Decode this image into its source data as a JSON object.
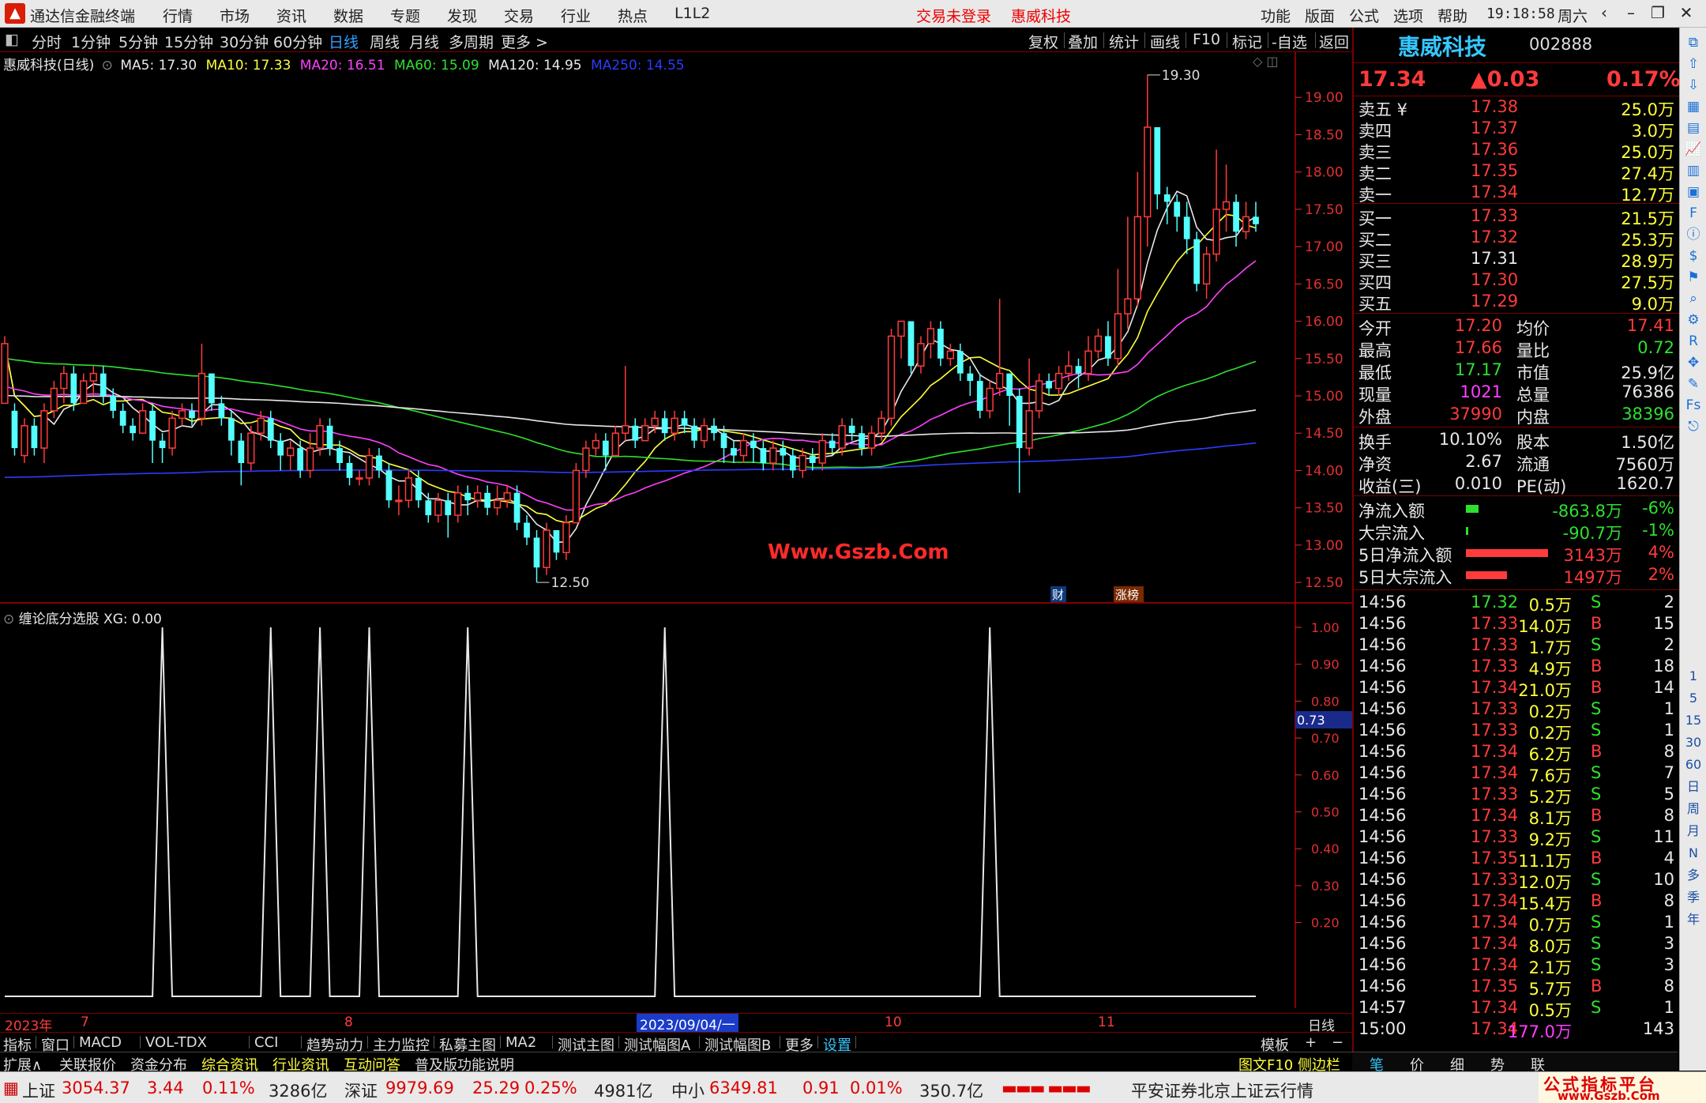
{
  "menubar": {
    "app_name": "通达信金融终端",
    "menus": [
      "行情",
      "市场",
      "资讯",
      "数据",
      "专题",
      "发现",
      "交易",
      "行业",
      "热点",
      "L1L2"
    ],
    "login_status": "交易未登录",
    "stock_title": "惠威科技",
    "right_menus": [
      "功能",
      "版面",
      "公式",
      "选项",
      "帮助"
    ],
    "time": "19:18:58",
    "weekday": "周六"
  },
  "period_bar": {
    "periods": [
      "分时",
      "1分钟",
      "5分钟",
      "15分钟",
      "30分钟",
      "60分钟",
      "日线",
      "周线",
      "月线",
      "多周期",
      "更多 >"
    ],
    "active": "日线",
    "tools": [
      "复权",
      "叠加",
      "统计",
      "画线",
      "F10",
      "标记",
      "-自选",
      "返回"
    ]
  },
  "main_chart": {
    "title": "惠威科技(日线)",
    "ma": [
      {
        "label": "MA5: 17.30",
        "color": "#e8e8e8"
      },
      {
        "label": "MA10: 17.33",
        "color": "#ffff3b"
      },
      {
        "label": "MA20: 16.51",
        "color": "#ff40ff"
      },
      {
        "label": "MA60: 15.09",
        "color": "#2ee02e"
      },
      {
        "label": "MA120: 14.95",
        "color": "#e8e8e8"
      },
      {
        "label": "MA250: 14.55",
        "color": "#2a3cff"
      }
    ],
    "high_label": "19.30",
    "low_label": "12.50",
    "watermark": "Www.Gszb.Com",
    "badges": [
      "财",
      "涨榜"
    ],
    "price_axis": [
      "19.00",
      "18.50",
      "18.00",
      "17.50",
      "17.00",
      "16.50",
      "16.00",
      "15.50",
      "15.00",
      "14.50",
      "14.00",
      "13.50",
      "13.00",
      "12.50"
    ],
    "axis_color": "#e03030"
  },
  "chart_data": {
    "type": "candlestick",
    "title": "惠威科技(日线)",
    "ylim": [
      12.3,
      19.5
    ],
    "x_labels": [
      "2023年",
      "7",
      "8",
      "2023/09/04/一",
      "10",
      "11"
    ],
    "candles": [
      [
        14.9,
        15.7,
        15.0,
        15.8
      ],
      [
        14.8,
        14.3,
        14.2,
        14.9
      ],
      [
        14.2,
        14.6,
        14.1,
        14.7
      ],
      [
        14.6,
        14.3,
        14.2,
        14.7
      ],
      [
        14.3,
        14.8,
        14.1,
        14.9
      ],
      [
        14.8,
        15.1,
        14.7,
        15.2
      ],
      [
        15.1,
        15.3,
        14.9,
        15.4
      ],
      [
        15.3,
        14.9,
        14.8,
        15.4
      ],
      [
        14.9,
        15.2,
        14.9,
        15.3
      ],
      [
        15.2,
        15.3,
        15.0,
        15.4
      ],
      [
        15.3,
        15.0,
        14.9,
        15.4
      ],
      [
        15.0,
        14.8,
        14.7,
        15.1
      ],
      [
        14.8,
        14.6,
        14.5,
        14.9
      ],
      [
        14.6,
        14.5,
        14.4,
        14.7
      ],
      [
        14.5,
        14.8,
        14.5,
        14.9
      ],
      [
        14.8,
        14.4,
        14.1,
        14.9
      ],
      [
        14.4,
        14.3,
        14.1,
        14.5
      ],
      [
        14.3,
        14.7,
        14.2,
        14.8
      ],
      [
        14.7,
        14.8,
        14.6,
        14.9
      ],
      [
        14.8,
        14.7,
        14.6,
        14.9
      ],
      [
        14.7,
        15.3,
        14.6,
        15.7
      ],
      [
        15.3,
        14.9,
        14.8,
        15.3
      ],
      [
        14.9,
        14.7,
        14.6,
        15.0
      ],
      [
        14.7,
        14.4,
        14.2,
        14.8
      ],
      [
        14.4,
        14.1,
        13.8,
        14.5
      ],
      [
        14.1,
        14.5,
        14.0,
        14.6
      ],
      [
        14.5,
        14.7,
        14.4,
        14.8
      ],
      [
        14.7,
        14.4,
        14.3,
        14.8
      ],
      [
        14.4,
        14.2,
        14.0,
        14.5
      ],
      [
        14.2,
        14.3,
        14.0,
        14.4
      ],
      [
        14.3,
        14.0,
        13.9,
        14.4
      ],
      [
        14.0,
        14.3,
        13.9,
        14.5
      ],
      [
        14.3,
        14.6,
        14.2,
        14.7
      ],
      [
        14.6,
        14.3,
        14.2,
        14.7
      ],
      [
        14.3,
        14.1,
        14.0,
        14.4
      ],
      [
        14.1,
        13.9,
        13.8,
        14.2
      ],
      [
        13.9,
        13.9,
        13.8,
        14.0
      ],
      [
        13.9,
        14.2,
        13.8,
        14.3
      ],
      [
        14.2,
        14.0,
        13.9,
        14.3
      ],
      [
        14.0,
        13.6,
        13.5,
        14.1
      ],
      [
        13.6,
        13.6,
        13.4,
        13.8
      ],
      [
        13.6,
        13.9,
        13.5,
        14.0
      ],
      [
        13.9,
        13.6,
        13.5,
        14.0
      ],
      [
        13.6,
        13.4,
        13.3,
        13.7
      ],
      [
        13.4,
        13.6,
        13.3,
        13.7
      ],
      [
        13.6,
        13.4,
        13.1,
        13.7
      ],
      [
        13.4,
        13.7,
        13.3,
        13.8
      ],
      [
        13.7,
        13.6,
        13.4,
        13.8
      ],
      [
        13.6,
        13.7,
        13.5,
        13.8
      ],
      [
        13.7,
        13.5,
        13.4,
        13.8
      ],
      [
        13.5,
        13.6,
        13.4,
        13.8
      ],
      [
        13.6,
        13.7,
        13.5,
        13.8
      ],
      [
        13.7,
        13.3,
        13.2,
        13.8
      ],
      [
        13.3,
        13.1,
        13.0,
        13.4
      ],
      [
        13.1,
        12.7,
        12.5,
        13.2
      ],
      [
        12.7,
        13.2,
        12.6,
        13.3
      ],
      [
        13.2,
        12.9,
        12.8,
        13.2
      ],
      [
        12.9,
        13.3,
        12.8,
        13.4
      ],
      [
        13.3,
        14.0,
        13.3,
        14.1
      ],
      [
        14.0,
        14.3,
        13.9,
        14.4
      ],
      [
        14.3,
        14.4,
        14.2,
        14.5
      ],
      [
        14.4,
        14.2,
        14.0,
        14.5
      ],
      [
        14.2,
        14.5,
        14.2,
        14.6
      ],
      [
        14.5,
        14.6,
        14.4,
        15.4
      ],
      [
        14.6,
        14.4,
        14.3,
        14.7
      ],
      [
        14.4,
        14.6,
        14.4,
        14.7
      ],
      [
        14.6,
        14.7,
        14.5,
        14.8
      ],
      [
        14.7,
        14.5,
        14.4,
        14.8
      ],
      [
        14.5,
        14.7,
        14.4,
        14.8
      ],
      [
        14.7,
        14.6,
        14.5,
        14.8
      ],
      [
        14.6,
        14.4,
        14.3,
        14.7
      ],
      [
        14.4,
        14.6,
        14.3,
        14.7
      ],
      [
        14.6,
        14.5,
        14.4,
        14.7
      ],
      [
        14.5,
        14.3,
        14.1,
        14.6
      ],
      [
        14.3,
        14.2,
        14.1,
        14.4
      ],
      [
        14.2,
        14.4,
        14.1,
        14.5
      ],
      [
        14.4,
        14.3,
        14.1,
        14.5
      ],
      [
        14.3,
        14.1,
        14.0,
        14.4
      ],
      [
        14.1,
        14.3,
        14.0,
        14.4
      ],
      [
        14.3,
        14.2,
        14.0,
        14.4
      ],
      [
        14.2,
        14.0,
        13.9,
        14.3
      ],
      [
        14.0,
        14.2,
        13.9,
        14.3
      ],
      [
        14.2,
        14.1,
        14.0,
        14.3
      ],
      [
        14.1,
        14.4,
        14.0,
        14.5
      ],
      [
        14.4,
        14.3,
        14.2,
        14.5
      ],
      [
        14.3,
        14.6,
        14.2,
        14.7
      ],
      [
        14.6,
        14.5,
        14.4,
        14.7
      ],
      [
        14.5,
        14.3,
        14.2,
        14.6
      ],
      [
        14.3,
        14.5,
        14.2,
        14.6
      ],
      [
        14.5,
        14.7,
        14.4,
        14.8
      ],
      [
        14.7,
        15.8,
        14.6,
        15.9
      ],
      [
        15.8,
        16.0,
        15.5,
        16.0
      ],
      [
        16.0,
        15.4,
        15.3,
        16.0
      ],
      [
        15.4,
        15.7,
        15.3,
        15.8
      ],
      [
        15.7,
        15.9,
        15.5,
        16.0
      ],
      [
        15.9,
        15.5,
        15.4,
        16.0
      ],
      [
        15.5,
        15.6,
        15.4,
        15.7
      ],
      [
        15.6,
        15.3,
        15.2,
        15.7
      ],
      [
        15.3,
        15.2,
        15.0,
        15.4
      ],
      [
        15.2,
        14.8,
        14.7,
        15.3
      ],
      [
        14.8,
        15.1,
        14.7,
        15.2
      ],
      [
        15.1,
        15.3,
        15.0,
        16.3
      ],
      [
        15.3,
        15.0,
        14.6,
        15.3
      ],
      [
        15.0,
        14.3,
        13.7,
        15.1
      ],
      [
        14.3,
        14.8,
        14.2,
        15.5
      ],
      [
        14.8,
        15.2,
        14.7,
        15.3
      ],
      [
        15.2,
        15.1,
        15.0,
        15.3
      ],
      [
        15.1,
        15.3,
        15.0,
        15.4
      ],
      [
        15.3,
        15.4,
        15.2,
        15.6
      ],
      [
        15.4,
        15.3,
        15.1,
        15.5
      ],
      [
        15.3,
        15.6,
        15.2,
        15.8
      ],
      [
        15.6,
        15.8,
        15.5,
        15.9
      ],
      [
        15.8,
        15.5,
        15.4,
        16.0
      ],
      [
        15.5,
        16.1,
        15.4,
        16.7
      ],
      [
        16.1,
        16.3,
        15.9,
        17.4
      ],
      [
        16.3,
        17.4,
        16.2,
        18.0
      ],
      [
        17.4,
        18.6,
        17.0,
        19.3
      ],
      [
        18.6,
        17.7,
        17.5,
        18.0
      ],
      [
        17.7,
        17.6,
        17.3,
        17.8
      ],
      [
        17.6,
        17.4,
        17.2,
        17.7
      ],
      [
        17.4,
        17.1,
        16.9,
        17.6
      ],
      [
        17.1,
        16.5,
        16.4,
        17.2
      ],
      [
        16.5,
        16.9,
        16.3,
        17.0
      ],
      [
        16.9,
        17.5,
        16.8,
        18.3
      ],
      [
        17.5,
        17.6,
        17.2,
        18.1
      ],
      [
        17.6,
        17.2,
        17.0,
        17.7
      ],
      [
        17.2,
        17.4,
        17.1,
        17.6
      ],
      [
        17.4,
        17.3,
        17.2,
        17.6
      ]
    ]
  },
  "indicator": {
    "title": "缠论底分选股 XG: 0.00",
    "current_value_label": "0.73",
    "axis": [
      "1.00",
      "0.90",
      "0.80",
      "0.70",
      "0.60",
      "0.50",
      "0.40",
      "0.30",
      "0.20"
    ],
    "signal_days": [
      16,
      27,
      32,
      37,
      47,
      67,
      100
    ]
  },
  "date_axis": [
    "2023年",
    "7",
    "8",
    "2023/09/04/一",
    "10",
    "11",
    "日线"
  ],
  "tabbar1": [
    "指标",
    "窗口",
    "MACD",
    "VOL-TDX",
    "CCI",
    "趋势动力",
    "主力监控",
    "私募主图",
    "MA2",
    "测试主图",
    "测试幅图A",
    "测试幅图B",
    "更多",
    "设置"
  ],
  "tabbar1_right": [
    "模板",
    "+",
    "−"
  ],
  "tabbar2": [
    "扩展∧",
    "关联报价",
    "资金分布",
    "综合资讯",
    "行业资讯",
    "互动问答",
    "普及版功能说明"
  ],
  "tabbar2_right": "图文F10 侧边栏 《",
  "quote": {
    "name": "惠威科技",
    "code": "002888",
    "price": "17.34",
    "change": "▲0.03",
    "pct": "0.17%",
    "asks": [
      {
        "label": "卖五 ¥",
        "price": "17.38",
        "vol": "25.0万"
      },
      {
        "label": "卖四",
        "price": "17.37",
        "vol": "3.0万"
      },
      {
        "label": "卖三",
        "price": "17.36",
        "vol": "25.0万"
      },
      {
        "label": "卖二",
        "price": "17.35",
        "vol": "27.4万"
      },
      {
        "label": "卖一",
        "price": "17.34",
        "vol": "12.7万"
      }
    ],
    "bids": [
      {
        "label": "买一",
        "price": "17.33",
        "vol": "21.5万"
      },
      {
        "label": "买二",
        "price": "17.32",
        "vol": "25.3万"
      },
      {
        "label": "买三",
        "price": "17.31",
        "vol": "28.9万"
      },
      {
        "label": "买四",
        "price": "17.30",
        "vol": "27.5万"
      },
      {
        "label": "买五",
        "price": "17.29",
        "vol": "9.0万"
      }
    ],
    "stats1": [
      {
        "l1": "今开",
        "v1": "17.20",
        "l2": "均价",
        "v2": "17.41"
      },
      {
        "l1": "最高",
        "v1": "17.66",
        "l2": "量比",
        "v2": "0.72"
      },
      {
        "l1": "最低",
        "v1": "17.17",
        "l2": "市值",
        "v2": "25.9亿"
      },
      {
        "l1": "现量",
        "v1": "1021",
        "l2": "总量",
        "v2": "76386"
      },
      {
        "l1": "外盘",
        "v1": "37990",
        "l2": "内盘",
        "v2": "38396"
      }
    ],
    "stats2": [
      {
        "l1": "换手",
        "v1": "10.10%",
        "l2": "股本",
        "v2": "1.50亿"
      },
      {
        "l1": "净资",
        "v1": "2.67",
        "l2": "流通",
        "v2": "7560万"
      },
      {
        "l1": "收益(三)",
        "v1": "0.010",
        "l2": "PE(动)",
        "v2": "1620.7"
      }
    ],
    "flows": [
      {
        "label": "净流入额",
        "value": "-863.8万",
        "pct": "-6%",
        "bar": 0.06,
        "color": "#2ee02e"
      },
      {
        "label": "大宗流入",
        "value": "-90.7万",
        "pct": "-1%",
        "bar": 0.01,
        "color": "#2ee02e"
      },
      {
        "label": "5日净流入额",
        "value": "3143万",
        "pct": "4%",
        "bar": 0.4,
        "color": "#ff3b3b"
      },
      {
        "label": "5日大宗流入",
        "value": "1497万",
        "pct": "2%",
        "bar": 0.2,
        "color": "#ff3b3b"
      }
    ],
    "ticks": [
      {
        "t": "14:56",
        "p": "17.32",
        "v": "0.5万",
        "s": "S",
        "n": "2"
      },
      {
        "t": "14:56",
        "p": "17.33",
        "v": "14.0万",
        "s": "B",
        "n": "15"
      },
      {
        "t": "14:56",
        "p": "17.33",
        "v": "1.7万",
        "s": "S",
        "n": "2"
      },
      {
        "t": "14:56",
        "p": "17.33",
        "v": "4.9万",
        "s": "B",
        "n": "18"
      },
      {
        "t": "14:56",
        "p": "17.34",
        "v": "21.0万",
        "s": "B",
        "n": "14"
      },
      {
        "t": "14:56",
        "p": "17.33",
        "v": "0.2万",
        "s": "S",
        "n": "1"
      },
      {
        "t": "14:56",
        "p": "17.33",
        "v": "0.2万",
        "s": "S",
        "n": "1"
      },
      {
        "t": "14:56",
        "p": "17.34",
        "v": "6.2万",
        "s": "B",
        "n": "8"
      },
      {
        "t": "14:56",
        "p": "17.34",
        "v": "7.6万",
        "s": "S",
        "n": "7"
      },
      {
        "t": "14:56",
        "p": "17.33",
        "v": "5.2万",
        "s": "S",
        "n": "5"
      },
      {
        "t": "14:56",
        "p": "17.34",
        "v": "8.1万",
        "s": "B",
        "n": "8"
      },
      {
        "t": "14:56",
        "p": "17.33",
        "v": "9.2万",
        "s": "S",
        "n": "11"
      },
      {
        "t": "14:56",
        "p": "17.35",
        "v": "11.1万",
        "s": "B",
        "n": "4"
      },
      {
        "t": "14:56",
        "p": "17.33",
        "v": "12.0万",
        "s": "S",
        "n": "10"
      },
      {
        "t": "14:56",
        "p": "17.34",
        "v": "15.4万",
        "s": "B",
        "n": "8"
      },
      {
        "t": "14:56",
        "p": "17.34",
        "v": "0.7万",
        "s": "S",
        "n": "1"
      },
      {
        "t": "14:56",
        "p": "17.34",
        "v": "8.0万",
        "s": "S",
        "n": "3"
      },
      {
        "t": "14:56",
        "p": "17.34",
        "v": "2.1万",
        "s": "S",
        "n": "3"
      },
      {
        "t": "14:56",
        "p": "17.35",
        "v": "5.7万",
        "s": "B",
        "n": "8"
      },
      {
        "t": "14:57",
        "p": "17.34",
        "v": "0.5万",
        "s": "S",
        "n": "1"
      },
      {
        "t": "15:00",
        "p": "17.34",
        "v": "177.0万",
        "s": "",
        "n": "143"
      }
    ],
    "bottom_tabs": [
      "笔",
      "价",
      "细",
      "势",
      "联"
    ]
  },
  "icon_column": [
    "collapse-icon",
    "up-arrow-icon",
    "down-arrow-icon",
    "grid-icon",
    "list-icon",
    "chart-icon",
    "kline-icon",
    "news-icon",
    "f10-icon",
    "info-icon",
    "finance-icon",
    "flag-icon",
    "search-icon",
    "settings-icon",
    "rsi-icon",
    "move-icon",
    "pen-icon",
    "fs-icon",
    "share-icon"
  ],
  "icon_column_labels": [
    "1",
    "5",
    "15",
    "30",
    "60",
    "日",
    "周",
    "月",
    "N",
    "多",
    "季",
    "年"
  ],
  "status": {
    "indices": [
      {
        "name": "上证",
        "value": "3054.37",
        "chg": "3.44",
        "pct": "0.11%",
        "amt": "3286亿"
      },
      {
        "name": "深证",
        "value": "9979.69",
        "chg": "25.29",
        "pct": "0.25%",
        "amt": "4981亿"
      },
      {
        "name": "中小",
        "value": "6349.81",
        "chg": "0.91",
        "pct": "0.01%",
        "amt": "350.7亿"
      }
    ],
    "broker": "平安证券北京上证云行情",
    "brand": "公式指标平台",
    "brand_url": "www.Gszb.Com"
  }
}
